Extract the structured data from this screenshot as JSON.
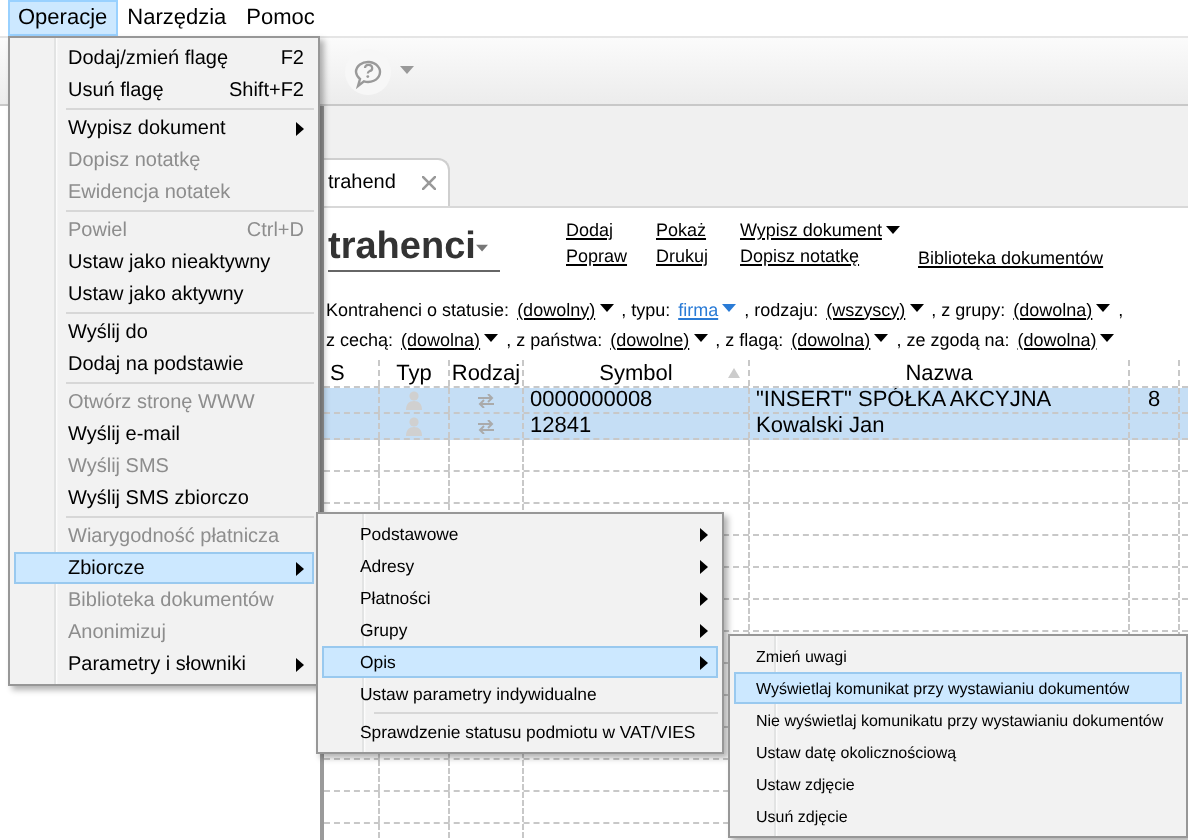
{
  "menubar": [
    {
      "label": "Operacje",
      "selected": true
    },
    {
      "label": "Narzędzia",
      "selected": false
    },
    {
      "label": "Pomoc",
      "selected": false
    }
  ],
  "tab": {
    "label": "trahend"
  },
  "title": "trahenci",
  "actions": [
    [
      {
        "label": "Dodaj",
        "dropdown": false
      },
      {
        "label": "Popraw",
        "dropdown": false
      }
    ],
    [
      {
        "label": "Pokaż",
        "dropdown": false
      },
      {
        "label": "Drukuj",
        "dropdown": false
      }
    ],
    [
      {
        "label": "Wypisz dokument",
        "dropdown": true
      },
      {
        "label": "Dopisz notatkę",
        "dropdown": false
      }
    ],
    [
      {
        "label": "Biblioteka dokumentów",
        "dropdown": false
      }
    ]
  ],
  "filters": [
    {
      "items": [
        {
          "label": "Kontrahenci o statusie:",
          "value": "(dowolny)",
          "active": false
        },
        {
          "label": ", typu:",
          "value": "firma",
          "active": true
        },
        {
          "label": ", rodzaju:",
          "value": "(wszyscy)",
          "active": false
        },
        {
          "label": ", z grupy:",
          "value": "(dowolna)",
          "active": false
        }
      ],
      "end": ","
    },
    {
      "items": [
        {
          "label": "z cechą:",
          "value": "(dowolna)",
          "active": false
        },
        {
          "label": ", z państwa:",
          "value": "(dowolne)",
          "active": false
        },
        {
          "label": ", z flagą:",
          "value": "(dowolna)",
          "active": false
        },
        {
          "label": ", ze zgodą na:",
          "value": "(dowolna)",
          "active": false
        }
      ]
    }
  ],
  "table": {
    "columns": [
      {
        "label": "S",
        "sorted": false
      },
      {
        "label": "Typ",
        "sorted": false
      },
      {
        "label": "Rodzaj",
        "sorted": false
      },
      {
        "label": "Symbol",
        "sorted": true
      },
      {
        "label": "Nazwa",
        "sorted": false
      }
    ],
    "rows": [
      {
        "selected": true,
        "symbol": "0000000008",
        "nazwa": "\"INSERT\" SPÓŁKA AKCYJNA",
        "column_6": "8"
      },
      {
        "selected": true,
        "symbol": "12841",
        "nazwa": "Kowalski Jan"
      }
    ]
  },
  "menu": [
    {
      "kind": "item",
      "label": "Dodaj/zmień flagę",
      "shortcut": "F2",
      "submenu": false,
      "disabled": false,
      "selected": false
    },
    {
      "kind": "item",
      "label": "Usuń flagę",
      "shortcut": "Shift+F2",
      "submenu": false,
      "disabled": false,
      "selected": false
    },
    {
      "kind": "separator"
    },
    {
      "kind": "item",
      "label": "Wypisz dokument",
      "submenu": true,
      "disabled": false,
      "selected": false
    },
    {
      "kind": "item",
      "label": "Dopisz notatkę",
      "submenu": false,
      "disabled": true,
      "selected": false
    },
    {
      "kind": "item",
      "label": "Ewidencja notatek",
      "submenu": false,
      "disabled": true,
      "selected": false
    },
    {
      "kind": "separator"
    },
    {
      "kind": "item",
      "label": "Powiel",
      "shortcut": "Ctrl+D",
      "submenu": false,
      "disabled": true,
      "selected": false
    },
    {
      "kind": "item",
      "label": "Ustaw jako nieaktywny",
      "submenu": false,
      "disabled": false,
      "selected": false
    },
    {
      "kind": "item",
      "label": "Ustaw jako aktywny",
      "submenu": false,
      "disabled": false,
      "selected": false
    },
    {
      "kind": "separator"
    },
    {
      "kind": "item",
      "label": "Wyślij do",
      "submenu": false,
      "disabled": false,
      "selected": false
    },
    {
      "kind": "item",
      "label": "Dodaj na podstawie",
      "submenu": false,
      "disabled": false,
      "selected": false
    },
    {
      "kind": "separator"
    },
    {
      "kind": "item",
      "label": "Otwórz stronę WWW",
      "submenu": false,
      "disabled": true,
      "selected": false
    },
    {
      "kind": "item",
      "label": "Wyślij e-mail",
      "submenu": false,
      "disabled": false,
      "selected": false
    },
    {
      "kind": "item",
      "label": "Wyślij SMS",
      "submenu": false,
      "disabled": true,
      "selected": false
    },
    {
      "kind": "item",
      "label": "Wyślij SMS zbiorczo",
      "submenu": false,
      "disabled": false,
      "selected": false
    },
    {
      "kind": "separator"
    },
    {
      "kind": "item",
      "label": "Wiarygodność płatnicza",
      "submenu": false,
      "disabled": true,
      "selected": false
    },
    {
      "kind": "item",
      "label": "Zbiorcze",
      "submenu": true,
      "disabled": false,
      "selected": true
    },
    {
      "kind": "item",
      "label": "Biblioteka dokumentów",
      "submenu": false,
      "disabled": true,
      "selected": false
    },
    {
      "kind": "item",
      "label": "Anonimizuj",
      "submenu": false,
      "disabled": true,
      "selected": false
    },
    {
      "kind": "item",
      "label": "Parametry i słowniki",
      "submenu": true,
      "disabled": false,
      "selected": false
    }
  ],
  "submenu": [
    {
      "kind": "item",
      "label": "Podstawowe",
      "submenu": true,
      "disabled": false,
      "selected": false
    },
    {
      "kind": "item",
      "label": "Adresy",
      "submenu": true,
      "disabled": false,
      "selected": false
    },
    {
      "kind": "item",
      "label": "Płatności",
      "submenu": true,
      "disabled": false,
      "selected": false
    },
    {
      "kind": "item",
      "label": "Grupy",
      "submenu": true,
      "disabled": false,
      "selected": false
    },
    {
      "kind": "item",
      "label": "Opis",
      "submenu": true,
      "disabled": false,
      "selected": true
    },
    {
      "kind": "item",
      "label": "Ustaw parametry indywidualne",
      "submenu": false,
      "disabled": false,
      "selected": false
    },
    {
      "kind": "separator"
    },
    {
      "kind": "item",
      "label": "Sprawdzenie statusu podmiotu w VAT/VIES",
      "submenu": false,
      "disabled": false,
      "selected": false
    }
  ],
  "submenu_2": [
    {
      "kind": "item",
      "label": "Zmień uwagi",
      "submenu": false,
      "disabled": false,
      "selected": false
    },
    {
      "kind": "item",
      "label": "Wyświetlaj komunikat przy wystawianiu dokumentów",
      "submenu": false,
      "disabled": false,
      "selected": true
    },
    {
      "kind": "item",
      "label": "Nie wyświetlaj komunikatu przy wystawianiu dokumentów",
      "submenu": false,
      "disabled": false,
      "selected": false
    },
    {
      "kind": "item",
      "label": "Ustaw datę okolicznościową",
      "submenu": false,
      "disabled": false,
      "selected": false
    },
    {
      "kind": "item",
      "label": "Ustaw zdjęcie",
      "submenu": false,
      "disabled": false,
      "selected": false
    },
    {
      "kind": "item",
      "label": "Usuń zdjęcie",
      "submenu": false,
      "disabled": false,
      "selected": false
    }
  ]
}
